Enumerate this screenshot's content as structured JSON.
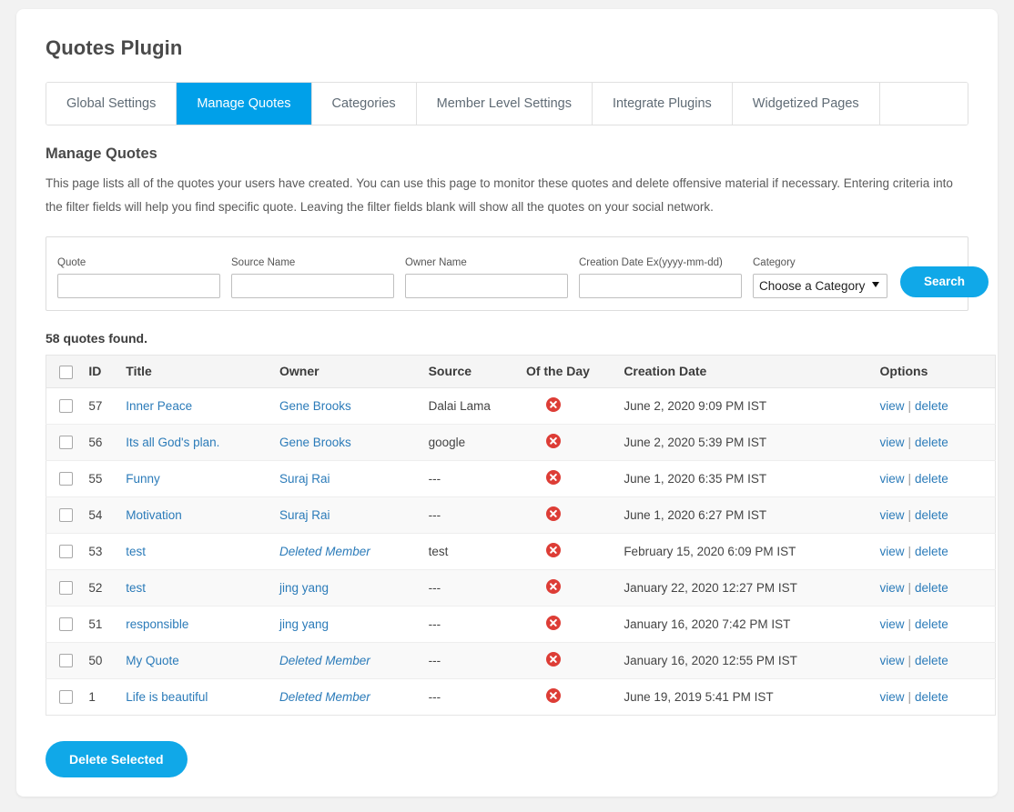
{
  "header": {
    "title": "Quotes Plugin"
  },
  "tabs": [
    {
      "label": "Global Settings",
      "active": false
    },
    {
      "label": "Manage Quotes",
      "active": true
    },
    {
      "label": "Categories",
      "active": false
    },
    {
      "label": "Member Level Settings",
      "active": false
    },
    {
      "label": "Integrate Plugins",
      "active": false
    },
    {
      "label": "Widgetized Pages",
      "active": false
    }
  ],
  "section": {
    "heading": "Manage Quotes",
    "description": "This page lists all of the quotes your users have created. You can use this page to monitor these quotes and delete offensive material if necessary. Entering criteria into the filter fields will help you find specific quote. Leaving the filter fields blank will show all the quotes on your social network."
  },
  "filter": {
    "quote": {
      "label": "Quote",
      "value": "",
      "placeholder": ""
    },
    "source_name": {
      "label": "Source Name",
      "value": "",
      "placeholder": ""
    },
    "owner_name": {
      "label": "Owner Name",
      "value": "",
      "placeholder": ""
    },
    "creation_date": {
      "label": "Creation Date Ex(yyyy-mm-dd)",
      "value": "",
      "placeholder": ""
    },
    "category": {
      "label": "Category",
      "selected": "Choose a Category",
      "options": [
        "Choose a Category"
      ]
    },
    "search_label": "Search"
  },
  "results": {
    "count_text": "58 quotes found.",
    "columns": [
      "ID",
      "Title",
      "Owner",
      "Source",
      "Of the Day",
      "Creation Date",
      "Options"
    ],
    "option_view_label": "view",
    "option_delete_label": "delete",
    "option_separator": "|",
    "of_the_day_icon": "circle-x-icon",
    "rows": [
      {
        "id": "57",
        "title": "Inner Peace",
        "owner": "Gene Brooks",
        "owner_deleted": false,
        "source": "Dalai Lama",
        "of_the_day": false,
        "creation_date": "June 2, 2020 9:09 PM IST"
      },
      {
        "id": "56",
        "title": "Its all God's plan.",
        "owner": "Gene Brooks",
        "owner_deleted": false,
        "source": "google",
        "of_the_day": false,
        "creation_date": "June 2, 2020 5:39 PM IST"
      },
      {
        "id": "55",
        "title": "Funny",
        "owner": "Suraj Rai",
        "owner_deleted": false,
        "source": "---",
        "of_the_day": false,
        "creation_date": "June 1, 2020 6:35 PM IST"
      },
      {
        "id": "54",
        "title": "Motivation",
        "owner": "Suraj Rai",
        "owner_deleted": false,
        "source": "---",
        "of_the_day": false,
        "creation_date": "June 1, 2020 6:27 PM IST"
      },
      {
        "id": "53",
        "title": "test",
        "owner": "Deleted Member",
        "owner_deleted": true,
        "source": "test",
        "of_the_day": false,
        "creation_date": "February 15, 2020 6:09 PM IST"
      },
      {
        "id": "52",
        "title": "test",
        "owner": "jing yang",
        "owner_deleted": false,
        "source": "---",
        "of_the_day": false,
        "creation_date": "January 22, 2020 12:27 PM IST"
      },
      {
        "id": "51",
        "title": "responsible",
        "owner": "jing yang",
        "owner_deleted": false,
        "source": "---",
        "of_the_day": false,
        "creation_date": "January 16, 2020 7:42 PM IST"
      },
      {
        "id": "50",
        "title": "My Quote",
        "owner": "Deleted Member",
        "owner_deleted": true,
        "source": "---",
        "of_the_day": false,
        "creation_date": "January 16, 2020 12:55 PM IST"
      },
      {
        "id": "1",
        "title": "Life is beautiful",
        "owner": "Deleted Member",
        "owner_deleted": true,
        "source": "---",
        "of_the_day": false,
        "creation_date": "June 19, 2019 5:41 PM IST"
      }
    ]
  },
  "footer": {
    "delete_selected_label": "Delete Selected"
  },
  "colors": {
    "accent_blue": "#00a0e9",
    "button_blue": "#10a8e8",
    "link_blue": "#2b7bb9",
    "danger_red": "#dd3d36",
    "page_bg": "#f2f2f2",
    "row_alt_bg": "#f9f9f9",
    "header_bg": "#f5f5f5"
  }
}
